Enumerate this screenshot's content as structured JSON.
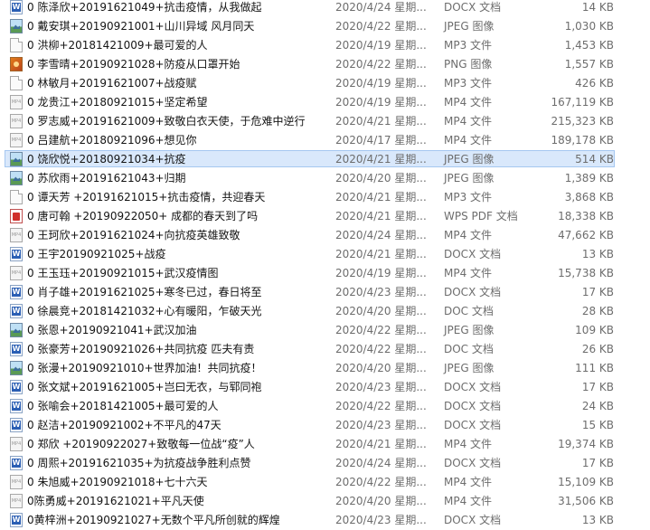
{
  "selected_index": 8,
  "files": [
    {
      "name": "0 陈泽欣+20191621049+抗击疫情，从我做起",
      "date": "2020/4/24 星期...",
      "type": "DOCX 文档",
      "size": "14 KB",
      "icon": "docx-icon"
    },
    {
      "name": "0 戴安琪+20190921001+山川异域 风月同天",
      "date": "2020/4/22 星期...",
      "type": "JPEG 图像",
      "size": "1,030 KB",
      "icon": "jpeg-icon"
    },
    {
      "name": "0 洪柳+20181421009+最可爱的人",
      "date": "2020/4/19 星期...",
      "type": "MP3 文件",
      "size": "1,453 KB",
      "icon": "mp3-icon"
    },
    {
      "name": "0 李雪晴+20190921028+防疫从口罩开始",
      "date": "2020/4/22 星期...",
      "type": "PNG 图像",
      "size": "1,557 KB",
      "icon": "png-icon"
    },
    {
      "name": "0 林敏月+20191621007+战疫赋",
      "date": "2020/4/19 星期...",
      "type": "MP3 文件",
      "size": "426 KB",
      "icon": "mp3-icon"
    },
    {
      "name": "0 龙贵江+20180921015+坚定希望",
      "date": "2020/4/19 星期...",
      "type": "MP4 文件",
      "size": "167,119 KB",
      "icon": "mp4-icon"
    },
    {
      "name": "0 罗志威+20191621009+致敬白衣天使，于危难中逆行",
      "date": "2020/4/21 星期...",
      "type": "MP4 文件",
      "size": "215,323 KB",
      "icon": "mp4-icon"
    },
    {
      "name": "0 吕建航+20180921096+想见你",
      "date": "2020/4/17 星期...",
      "type": "MP4 文件",
      "size": "189,178 KB",
      "icon": "mp4-icon"
    },
    {
      "name": "0 饶欣悦+20180921034+抗疫",
      "date": "2020/4/21 星期...",
      "type": "JPEG 图像",
      "size": "514 KB",
      "icon": "jpeg-icon"
    },
    {
      "name": "0 苏欣雨+20191621043+归期",
      "date": "2020/4/20 星期...",
      "type": "JPEG 图像",
      "size": "1,389 KB",
      "icon": "jpeg-icon"
    },
    {
      "name": "0 谭天芳 +20191621015+抗击疫情，共迎春天",
      "date": "2020/4/21 星期...",
      "type": "MP3 文件",
      "size": "3,868 KB",
      "icon": "mp3-icon"
    },
    {
      "name": "0 唐可翰 +20190922050+ 成都的春天到了吗",
      "date": "2020/4/21 星期...",
      "type": "WPS PDF 文档",
      "size": "18,338 KB",
      "icon": "pdf-icon"
    },
    {
      "name": "0 王珂欣+20191621024+向抗疫英雄致敬",
      "date": "2020/4/24 星期...",
      "type": "MP4 文件",
      "size": "47,662 KB",
      "icon": "mp4-icon"
    },
    {
      "name": "0 王宇20190921025+战疫",
      "date": "2020/4/21 星期...",
      "type": "DOCX 文档",
      "size": "13 KB",
      "icon": "docx-icon"
    },
    {
      "name": "0 王玉珏+20190921015+武汉疫情图",
      "date": "2020/4/19 星期...",
      "type": "MP4 文件",
      "size": "15,738 KB",
      "icon": "mp4-icon"
    },
    {
      "name": "0 肖子雄+20191621025+寒冬已过，春日将至",
      "date": "2020/4/23 星期...",
      "type": "DOCX 文档",
      "size": "17 KB",
      "icon": "docx-icon"
    },
    {
      "name": "0 徐晨竞+20181421032+心有暖阳，乍破天光",
      "date": "2020/4/20 星期...",
      "type": "DOC 文档",
      "size": "28 KB",
      "icon": "docx-icon"
    },
    {
      "name": "0 张恩+20190921041+武汉加油",
      "date": "2020/4/22 星期...",
      "type": "JPEG 图像",
      "size": "109 KB",
      "icon": "jpeg-icon"
    },
    {
      "name": "0 张豪芳+20190921026+共同抗疫 匹夫有责",
      "date": "2020/4/22 星期...",
      "type": "DOC 文档",
      "size": "26 KB",
      "icon": "docx-icon"
    },
    {
      "name": "0 张漫+20190921010+世界加油！共同抗疫！",
      "date": "2020/4/20 星期...",
      "type": "JPEG 图像",
      "size": "111 KB",
      "icon": "jpeg-icon"
    },
    {
      "name": "0 张文斌+20191621005+岂曰无衣，与郓同袍",
      "date": "2020/4/23 星期...",
      "type": "DOCX 文档",
      "size": "17 KB",
      "icon": "docx-icon"
    },
    {
      "name": "0 张喻会+20181421005+最可爱的人",
      "date": "2020/4/22 星期...",
      "type": "DOCX 文档",
      "size": "24 KB",
      "icon": "docx-icon"
    },
    {
      "name": "0 赵洁+20190921002+不平凡的47天",
      "date": "2020/4/23 星期...",
      "type": "DOCX 文档",
      "size": "15 KB",
      "icon": "docx-icon"
    },
    {
      "name": "0 郑欣 +20190922027+致敬每一位战“疫”人",
      "date": "2020/4/21 星期...",
      "type": "MP4 文件",
      "size": "19,374 KB",
      "icon": "mp4-icon"
    },
    {
      "name": "0 周熙+20191621035+为抗疫战争胜利点赞",
      "date": "2020/4/24 星期...",
      "type": "DOCX 文档",
      "size": "17 KB",
      "icon": "docx-icon"
    },
    {
      "name": "0 朱旭威+20190921018+七十六天",
      "date": "2020/4/22 星期...",
      "type": "MP4 文件",
      "size": "15,109 KB",
      "icon": "mp4-icon"
    },
    {
      "name": "0陈勇威+20191621021+平凡天使",
      "date": "2020/4/20 星期...",
      "type": "MP4 文件",
      "size": "31,506 KB",
      "icon": "mp4-icon"
    },
    {
      "name": "0黄梓洲+20190921027+无数个平凡所创就的辉煌",
      "date": "2020/4/23 星期...",
      "type": "DOCX 文档",
      "size": "13 KB",
      "icon": "docx-icon"
    }
  ]
}
